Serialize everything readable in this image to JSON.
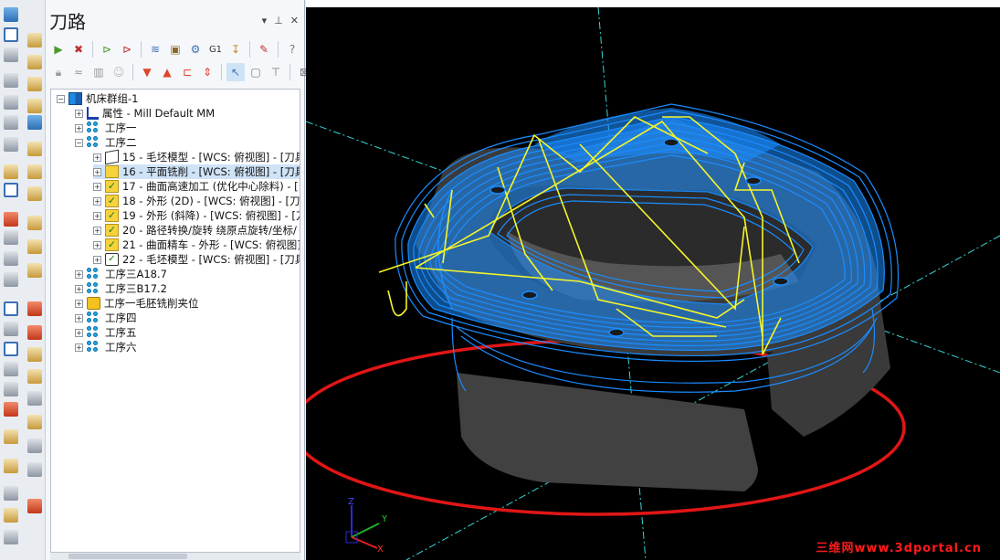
{
  "panel": {
    "title": "刀路",
    "pin_icon": "pin-icon",
    "close_icon": "close-icon"
  },
  "toolbar": {
    "g1_label": "G1"
  },
  "tree": {
    "root": "机床群组-1",
    "properties": "属性 - Mill Default MM",
    "groups": [
      "工序一",
      "工序二",
      "工序三A18.7",
      "工序三B17.2",
      "工序一毛胚铣削夹位",
      "工序四",
      "工序五",
      "工序六"
    ],
    "operations": [
      "15 - 毛坯模型 - [WCS: 俯视图] - [刀具",
      "16 - 平面铣削 - [WCS: 俯视图] - [刀具",
      "17 - 曲面高速加工 (优化中心除料) - [",
      "18 - 外形 (2D) - [WCS: 俯视图] - [刀具",
      "19 - 外形 (斜降) - [WCS: 俯视图] - [刀",
      "20 - 路径转换/旋转 绕原点旋转/坐标/",
      "21 - 曲面精车 - 外形 - [WCS: 俯视图]",
      "22 - 毛坯模型 - [WCS: 俯视图] - [刀具"
    ]
  },
  "viewport": {
    "background": "#000000",
    "axis_labels": {
      "x": "X",
      "y": "Y",
      "z": "Z"
    },
    "watermark": "三维网www.3dportal.cn",
    "colors": {
      "toolpath": "#1a8cff",
      "rapid": "#f5f52a",
      "stock_circle": "#e01616",
      "part": "#4a4a4a",
      "grid_lines": "#36d6d6"
    }
  }
}
